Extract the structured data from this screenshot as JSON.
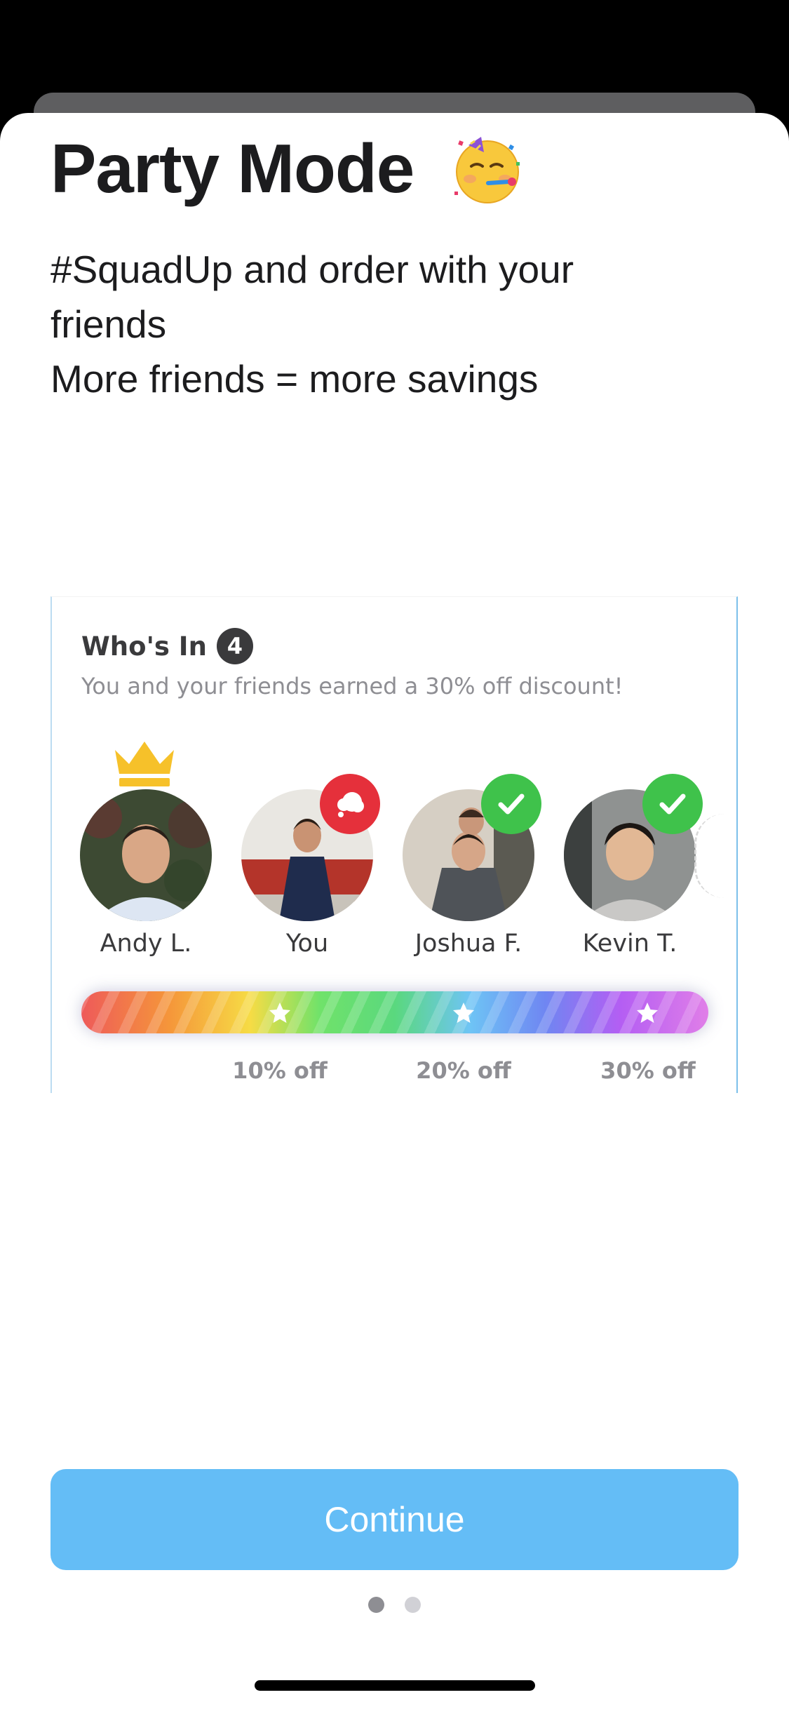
{
  "onboarding": {
    "title": "Party Mode",
    "title_emoji": "partying-face-emoji",
    "subtitle_lines": [
      "#SquadUp and order with your",
      "friends",
      "More friends = more savings"
    ]
  },
  "whos_in_card": {
    "title": "Who's In",
    "count": "4",
    "subtitle": "You and your friends earned a 30% off discount!",
    "friends": [
      {
        "name": "Andy L.",
        "badge": "crown-icon"
      },
      {
        "name": "You",
        "badge": "thought-bubble-icon"
      },
      {
        "name": "Joshua F.",
        "badge": "checkmark-icon"
      },
      {
        "name": "Kevin T.",
        "badge": "checkmark-icon"
      }
    ],
    "progress": {
      "value_percent": 100,
      "milestones": [
        {
          "label": "10% off",
          "icon": "star-icon"
        },
        {
          "label": "20% off",
          "icon": "star-icon"
        },
        {
          "label": "30% off",
          "icon": "star-icon"
        }
      ]
    }
  },
  "footer": {
    "continue_label": "Continue",
    "page_count": 2,
    "current_page": 1
  },
  "colors": {
    "accent": "#64bdf6",
    "check_badge": "#3fc24b",
    "pending_badge": "#e5303b",
    "crown": "#f6c12a"
  }
}
